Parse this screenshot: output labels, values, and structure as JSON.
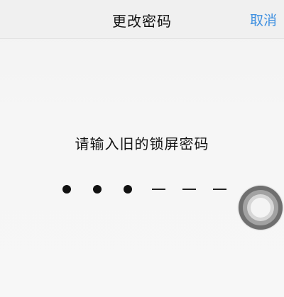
{
  "nav": {
    "title": "更改密码",
    "cancel_label": "取消"
  },
  "prompt": "请输入旧的锁屏密码",
  "passcode": {
    "length": 6,
    "entered": 3
  },
  "colors": {
    "accent": "#3d8fe0",
    "background": "#f4f4f4",
    "text": "#111111"
  },
  "icons": {
    "floating_button": "assistive-touch-icon"
  }
}
